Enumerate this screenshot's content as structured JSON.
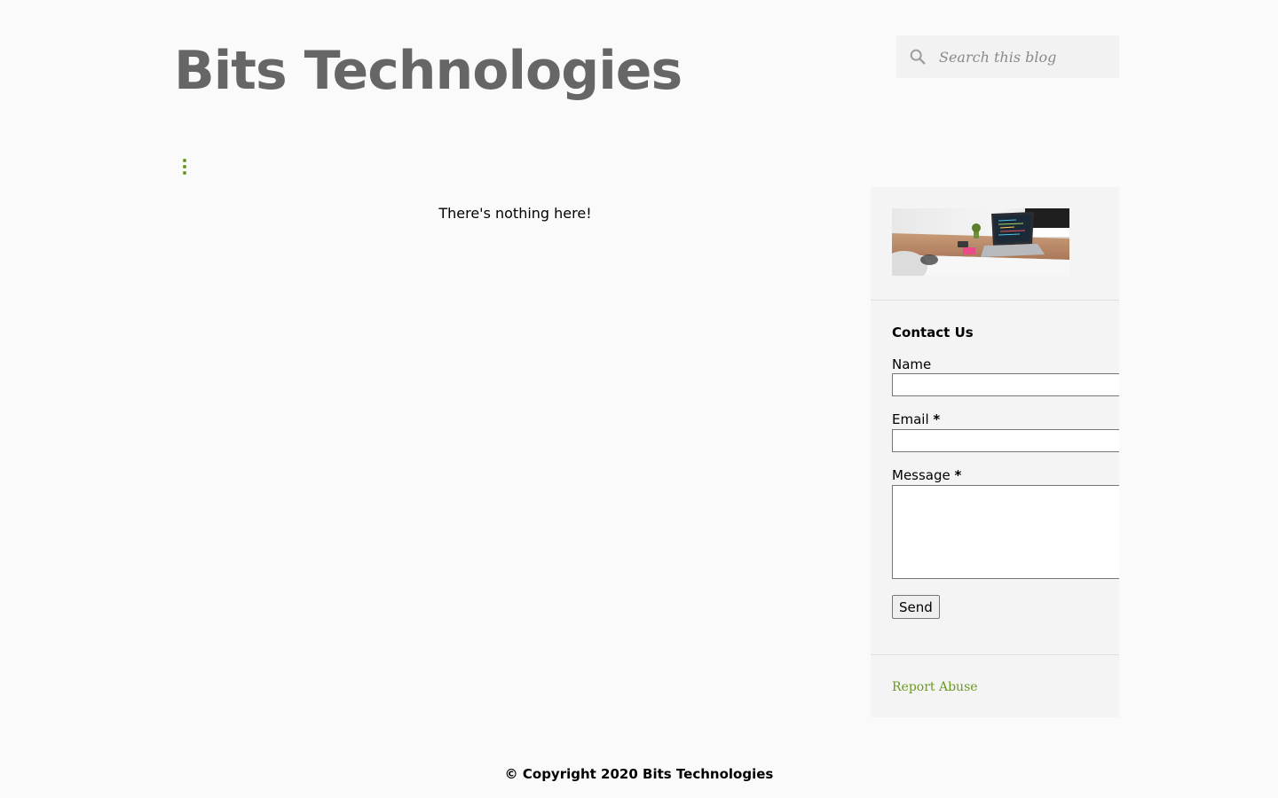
{
  "header": {
    "blog_title": "Bits Technologies"
  },
  "search": {
    "placeholder": "Search this blog",
    "icon": "search-icon"
  },
  "menu": {
    "icon": "more-vertical-icon",
    "accent_color": "#6a9a1f"
  },
  "main": {
    "empty_message": "There's nothing here!"
  },
  "sidebar": {
    "header_image": "laptop-desk-image",
    "contact": {
      "title": "Contact Us",
      "name_label": "Name",
      "email_label": "Email",
      "message_label": "Message",
      "required_marker": "*",
      "name_value": "",
      "email_value": "",
      "message_value": "",
      "send_label": "Send"
    },
    "report_abuse": "Report Abuse"
  },
  "footer": {
    "copyright": "© Copyright 2020 Bits Technologies"
  },
  "colors": {
    "page_background": "#fafafa",
    "title": "#666666",
    "link": "#6a9a1f",
    "sidebar_background": "#f4f4f4"
  }
}
